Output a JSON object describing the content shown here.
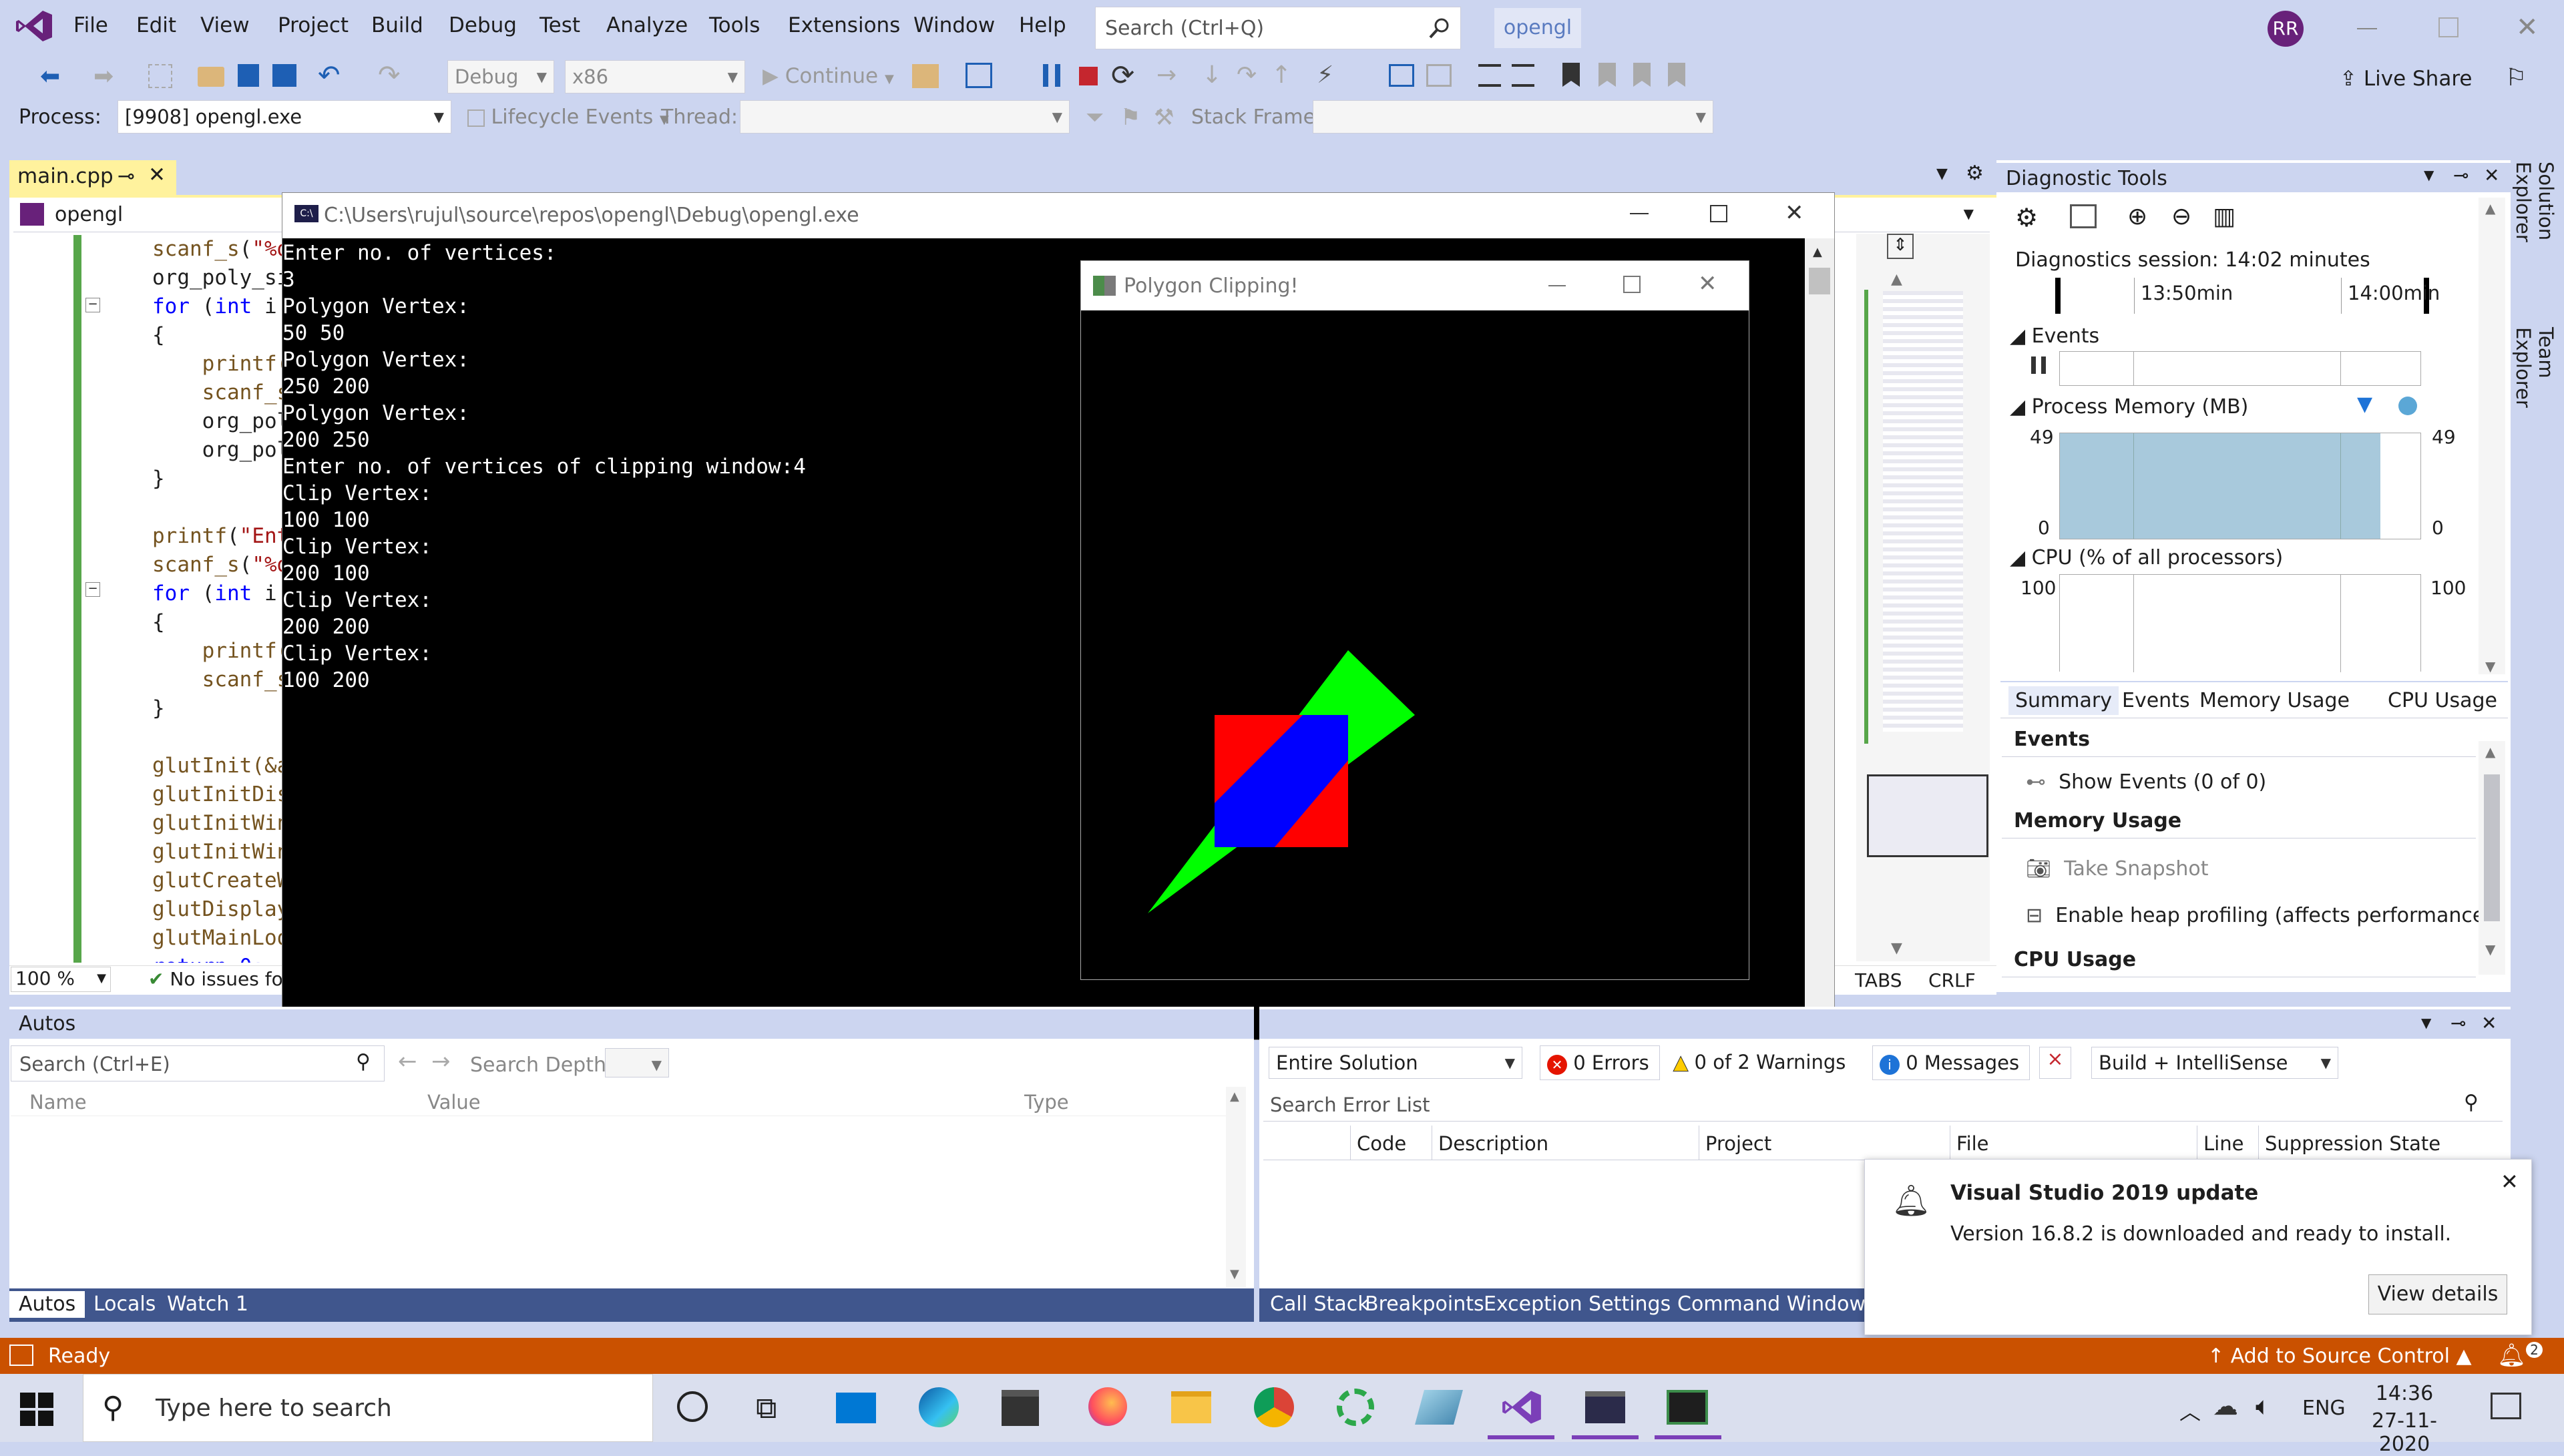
{
  "menu": {
    "items": [
      "File",
      "Edit",
      "View",
      "Project",
      "Build",
      "Debug",
      "Test",
      "Analyze",
      "Tools",
      "Extensions",
      "Window",
      "Help"
    ],
    "search_placeholder": "Search (Ctrl+Q)",
    "solution_name": "opengl",
    "user_initials": "RR",
    "live_share": "Live Share"
  },
  "toolbar": {
    "config": "Debug",
    "platform": "x86",
    "continue": "Continue"
  },
  "debugbar": {
    "process_label": "Process:",
    "process_value": "[9908] opengl.exe",
    "lifecycle": "Lifecycle Events",
    "thread_label": "Thread:",
    "stack_label": "Stack Frame:"
  },
  "editor": {
    "tab": "main.cpp",
    "nav_project": "opengl",
    "zoom": "100 %",
    "status": "No issues found",
    "tabs_mode": "TABS",
    "line_ending": "CRLF",
    "lines": [
      [
        {
          "t": "scanf_s(\"%d",
          "c": "str0"
        }
      ],
      [
        {
          "t": "org_poly_si",
          "c": ""
        }
      ],
      [
        {
          "t": "for",
          "c": "kw"
        },
        {
          "t": " (",
          "c": ""
        },
        {
          "t": "int",
          "c": "kw"
        },
        {
          "t": " i",
          "c": ""
        }
      ],
      [
        {
          "t": "{",
          "c": ""
        }
      ],
      [
        {
          "t": "    printf(",
          "c": "fn"
        }
      ],
      [
        {
          "t": "    scanf_s",
          "c": "fn"
        }
      ],
      [
        {
          "t": "    org_pol",
          "c": ""
        }
      ],
      [
        {
          "t": "    org_pol",
          "c": ""
        }
      ],
      [
        {
          "t": "}",
          "c": ""
        }
      ],
      [
        {
          "t": "",
          "c": ""
        }
      ],
      [
        {
          "t": "printf(\"Ent",
          "c": "mix"
        }
      ],
      [
        {
          "t": "scanf_s(\"%d",
          "c": "mix2"
        }
      ],
      [
        {
          "t": "for",
          "c": "kw"
        },
        {
          "t": " (",
          "c": ""
        },
        {
          "t": "int",
          "c": "kw"
        },
        {
          "t": " i",
          "c": ""
        }
      ],
      [
        {
          "t": "{",
          "c": ""
        }
      ],
      [
        {
          "t": "    printf(",
          "c": "fn"
        }
      ],
      [
        {
          "t": "    scanf_s",
          "c": "fn"
        }
      ],
      [
        {
          "t": "}",
          "c": ""
        }
      ],
      [
        {
          "t": "",
          "c": ""
        }
      ],
      [
        {
          "t": "glutInit(&a",
          "c": "fn"
        }
      ],
      [
        {
          "t": "glutInitDis",
          "c": "fn"
        }
      ],
      [
        {
          "t": "glutInitWin",
          "c": "fn"
        }
      ],
      [
        {
          "t": "glutInitWin",
          "c": "fn"
        }
      ],
      [
        {
          "t": "glutCreateW",
          "c": "fn"
        }
      ],
      [
        {
          "t": "glutDisplay",
          "c": "fn"
        }
      ],
      [
        {
          "t": "glutMainLoo",
          "c": "fn"
        }
      ],
      [
        {
          "t": "return 0;",
          "c": "kw"
        }
      ]
    ]
  },
  "console": {
    "title": "C:\\Users\\rujul\\source\\repos\\opengl\\Debug\\opengl.exe",
    "lines": [
      "Enter no. of vertices:",
      "3",
      "Polygon Vertex:",
      "50 50",
      "Polygon Vertex:",
      "250 200",
      "Polygon Vertex:",
      "200 250",
      "Enter no. of vertices of clipping window:4",
      "Clip Vertex:",
      "100 100",
      "Clip Vertex:",
      "200 100",
      "Clip Vertex:",
      "200 200",
      "Clip Vertex:",
      "100 200"
    ]
  },
  "glwindow": {
    "title": "Polygon Clipping!",
    "colors": {
      "polygon": "#00FF00",
      "clip": "#FF0000",
      "clipped": "#0000FF"
    }
  },
  "diagnostics": {
    "title": "Diagnostic Tools",
    "session": "Diagnostics session: 14:02 minutes",
    "t1": "13:50min",
    "t2": "14:00min",
    "events": "Events",
    "memory": "Process Memory (MB)",
    "mem_max": "49",
    "mem_min": "0",
    "cpu": "CPU (% of all processors)",
    "cpu_max": "100",
    "tabs": [
      "Summary",
      "Events",
      "Memory Usage",
      "CPU Usage"
    ],
    "sec_events": "Events",
    "show_events": "Show Events (0 of 0)",
    "sec_memory": "Memory Usage",
    "take_snapshot": "Take Snapshot",
    "heap": "Enable heap profiling (affects performance)",
    "sec_cpu": "CPU Usage"
  },
  "autos": {
    "title": "Autos",
    "search": "Search (Ctrl+E)",
    "depth": "Search Depth:",
    "cols": [
      "Name",
      "Value",
      "Type"
    ],
    "tabs": [
      "Autos",
      "Locals",
      "Watch 1"
    ]
  },
  "errorlist": {
    "scope": "Entire Solution",
    "errors": "0 Errors",
    "warnings": "0 of 2 Warnings",
    "messages": "0 Messages",
    "filter": "Build + IntelliSense",
    "search": "Search Error List",
    "cols": [
      "Code",
      "Description",
      "Project",
      "File",
      "Line",
      "Suppression State"
    ],
    "tabs": [
      "Call Stack",
      "Breakpoints",
      "Exception Settings",
      "Command Window"
    ]
  },
  "toast": {
    "title": "Visual Studio 2019 update",
    "body": "Version 16.8.2 is downloaded and ready to install.",
    "button": "View details"
  },
  "statusbar": {
    "ready": "Ready",
    "source_control": "Add to Source Control",
    "notif_count": "2"
  },
  "taskbar": {
    "search": "Type here to search",
    "lang": "ENG",
    "time": "14:36",
    "date": "27-11-2020"
  }
}
